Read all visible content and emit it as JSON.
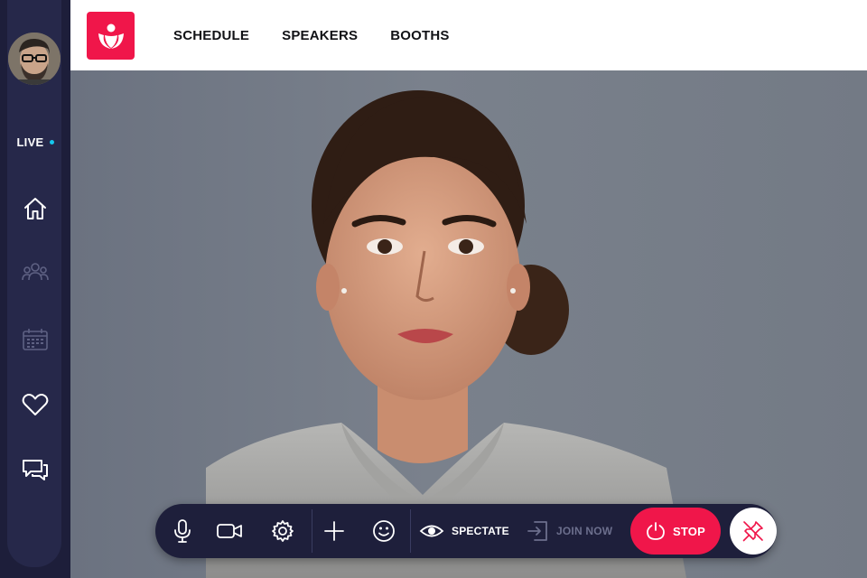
{
  "colors": {
    "brand": "#f0164a",
    "sidebar_bg": "#26284a",
    "page_bg": "#1d1e3a",
    "live_dot": "#14c8ee",
    "icon_active": "#ffffff",
    "icon_inactive": "#5e6183",
    "control_bar": "#1e1f3b",
    "disabled_text": "#6c6f8d"
  },
  "sidebar": {
    "live_label": "LIVE",
    "items": [
      {
        "icon": "home-icon",
        "active": true
      },
      {
        "icon": "people-icon",
        "active": false
      },
      {
        "icon": "calendar-icon",
        "active": false
      },
      {
        "icon": "heart-icon",
        "active": true
      },
      {
        "icon": "chat-icon",
        "active": true
      }
    ]
  },
  "header": {
    "menu": [
      {
        "label": "SCHEDULE"
      },
      {
        "label": "SPEAKERS"
      },
      {
        "label": "BOOTHS"
      }
    ]
  },
  "controls": {
    "icons": [
      "microphone-icon",
      "camera-icon",
      "settings-icon",
      "plus-icon",
      "emoji-icon"
    ],
    "spectate_label": "SPECTATE",
    "join_label": "JOIN NOW",
    "stop_label": "STOP",
    "pin_icon": "unpin-icon"
  }
}
